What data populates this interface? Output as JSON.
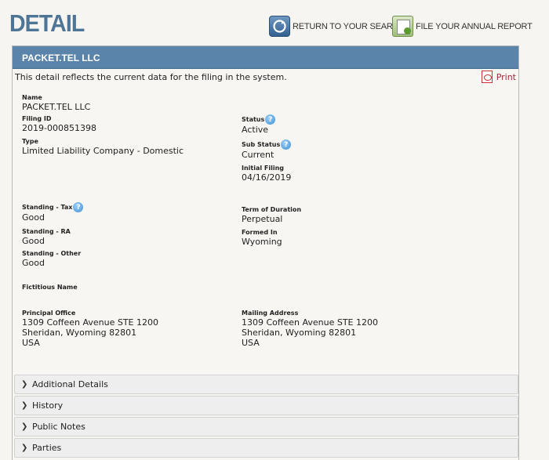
{
  "header": {
    "title": "DETAIL",
    "return_label": "RETURN TO YOUR SEARCH",
    "report_label": "FILE YOUR ANNUAL REPORT"
  },
  "panel": {
    "entity_name": "PACKET.TEL LLC",
    "intro": "This detail reflects the current data for the filing in the system.",
    "print_label": "Print"
  },
  "fields": {
    "name": {
      "label": "Name",
      "value": "PACKET.TEL LLC"
    },
    "filing_id": {
      "label": "Filing ID",
      "value": "2019-000851398"
    },
    "type": {
      "label": "Type",
      "value": "Limited Liability Company - Domestic"
    },
    "status": {
      "label": "Status",
      "value": "Active"
    },
    "sub_status": {
      "label": "Sub Status",
      "value": "Current"
    },
    "initial_filing": {
      "label": "Initial Filing",
      "value": "04/16/2019"
    },
    "standing_tax": {
      "label": "Standing - Tax",
      "value": "Good"
    },
    "standing_ra": {
      "label": "Standing - RA",
      "value": "Good"
    },
    "standing_other": {
      "label": "Standing - Other",
      "value": "Good"
    },
    "term": {
      "label": "Term of Duration",
      "value": "Perpetual"
    },
    "formed_in": {
      "label": "Formed In",
      "value": "Wyoming"
    },
    "fictitious": {
      "label": "Fictitious Name",
      "value": ""
    },
    "principal_office": {
      "label": "Principal Office",
      "line1": "1309 Coffeen Avenue STE 1200",
      "line2": "Sheridan, Wyoming 82801",
      "line3": "USA"
    },
    "mailing_address": {
      "label": "Mailing Address",
      "line1": "1309 Coffeen Avenue STE 1200",
      "line2": "Sheridan, Wyoming 82801",
      "line3": "USA"
    }
  },
  "help_glyph": "?",
  "chevron_glyph": "❯",
  "sections": [
    {
      "label": "Additional Details"
    },
    {
      "label": "History"
    },
    {
      "label": "Public Notes"
    },
    {
      "label": "Parties"
    }
  ]
}
